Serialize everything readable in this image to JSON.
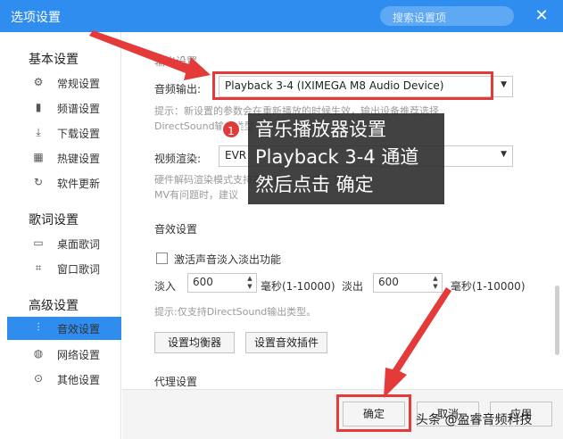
{
  "window": {
    "title": "选项设置",
    "search_placeholder": "搜索设置项",
    "close_symbol": "✕"
  },
  "sidebar": {
    "groups": [
      {
        "title": "基本设置",
        "items": [
          {
            "label": "常规设置",
            "icon": "gear-icon"
          },
          {
            "label": "频谱设置",
            "icon": "spectrum-icon"
          },
          {
            "label": "下载设置",
            "icon": "download-icon"
          },
          {
            "label": "热键设置",
            "icon": "keyboard-icon"
          },
          {
            "label": "软件更新",
            "icon": "update-icon"
          }
        ]
      },
      {
        "title": "歌词设置",
        "items": [
          {
            "label": "桌面歌词",
            "icon": "desktop-lyrics-icon"
          },
          {
            "label": "窗口歌词",
            "icon": "window-lyrics-icon"
          }
        ]
      },
      {
        "title": "高级设置",
        "items": [
          {
            "label": "音效设置",
            "icon": "equalizer-icon",
            "active": true
          },
          {
            "label": "网络设置",
            "icon": "globe-icon"
          },
          {
            "label": "其他设置",
            "icon": "more-icon"
          }
        ]
      }
    ]
  },
  "output": {
    "section_title": "输出设置",
    "audio_output_label": "音频输出:",
    "audio_output_value": "Playback 3-4 (IXIMEGA M8 Audio Device)",
    "audio_hint_line1": "提示：新设置的参数会在重新播放的时候生效，输出设备推荐选择",
    "audio_hint_line2": "DirectSound输出类型",
    "video_render_label": "视频渲染:",
    "video_render_value": "EVR",
    "video_hint_line1": "硬件解码渲染模式支持高清视频，该模式下播放",
    "video_hint_line2": "MV有问题时，建议"
  },
  "effects": {
    "section_title": "音效设置",
    "fade_checkbox_label": "激活声音淡入淡出功能",
    "fade_in_label": "淡入",
    "fade_in_value": "600",
    "fade_in_unit": "毫秒(1-10000)",
    "fade_out_label": "淡出",
    "fade_out_value": "600",
    "fade_out_unit": "毫秒(1-10000)",
    "hint": "提示:仅支持DirectSound输出类型。",
    "equalizer_button": "设置均衡器",
    "plugin_button": "设置音效插件"
  },
  "proxy": {
    "section_title": "代理设置"
  },
  "footer": {
    "ok_button": "确定",
    "cancel_button": "取消",
    "apply_button": "应用"
  },
  "annotation": {
    "badge_number": "1",
    "line1": "音乐播放器设置",
    "line2": "Playback 3-4 通道",
    "line3": "然后点击 确定",
    "highlight_color": "#e53a3a"
  },
  "watermark": "头条 @盈睿音频科技"
}
